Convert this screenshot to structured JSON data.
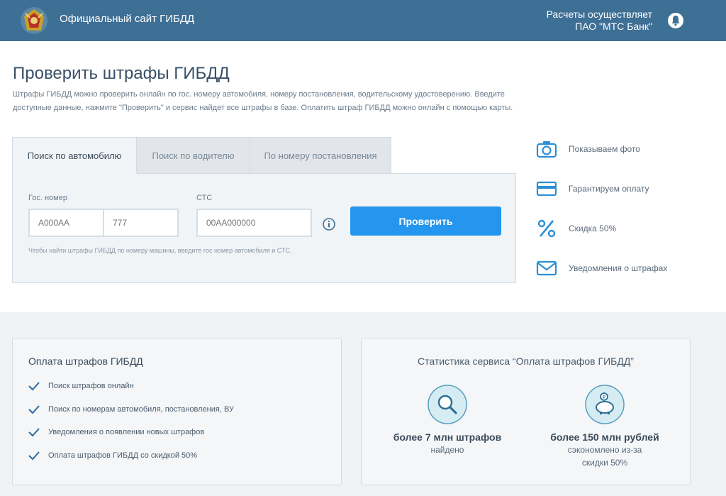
{
  "header": {
    "site_title": "Официальный сайт ГИБДД",
    "payer_line1": "Расчеты осуществляет",
    "payer_line2": "ПАО \"МТС Банк\"",
    "logo_icon": "gibdd-emblem-icon",
    "bell_icon": "bell-icon",
    "background_color": "#3e6f95"
  },
  "main": {
    "title": "Проверить штрафы ГИБДД",
    "intro": "Штрафы ГИБДД можно проверить онлайн по гос. номеру автомобиля, номеру постановления, водительскому удостоверению. Введите доступные данные, нажмите \"Проверить\" и сервис найдет все штрафы в базе. Оплатить штраф ГИБДД можно онлайн с помощью карты."
  },
  "tabs": [
    {
      "label": "Поиск по автомобилю",
      "active": true
    },
    {
      "label": "Поиск по водителю",
      "active": false
    },
    {
      "label": "По номеру постановления",
      "active": false
    }
  ],
  "form": {
    "plate_label": "Гос. номер",
    "plate_placeholder": "А000АА",
    "region_placeholder": "777",
    "sts_label": "СТС",
    "sts_placeholder": "00АА000000",
    "submit_label": "Проверить",
    "hint": "Чтобы найти штрафы ГИБДД по номеру машины, введите гос номер автомобиля и СТС.",
    "accent_color": "#2596ee"
  },
  "features": [
    {
      "icon": "camera-icon",
      "label": "Показываем фото"
    },
    {
      "icon": "credit-card-icon",
      "label": "Гарантируем оплату"
    },
    {
      "icon": "percent-icon",
      "label": "Скидка 50%"
    },
    {
      "icon": "envelope-icon",
      "label": "Уведомления о штрафах"
    }
  ],
  "payment_card": {
    "title": "Оплата штрафов ГИБДД",
    "items": [
      "Поиск штрафов онлайн",
      "Поиск по номерам автомобиля, постановления, ВУ",
      "Уведомления о появлении новых штрафов",
      "Оплата штрафов ГИБДД со скидкой 50%"
    ]
  },
  "stats_card": {
    "title": "Статистика сервиса “Оплата штрафов ГИБДД”",
    "stats": [
      {
        "icon": "magnifier-icon",
        "value": "более 7 млн штрафов",
        "desc_line1": "найдено",
        "desc_line2": ""
      },
      {
        "icon": "piggy-bank-icon",
        "value": "более 150 млн рублей",
        "desc_line1": "сэкономлено из-за",
        "desc_line2": "скидки 50%"
      }
    ]
  }
}
